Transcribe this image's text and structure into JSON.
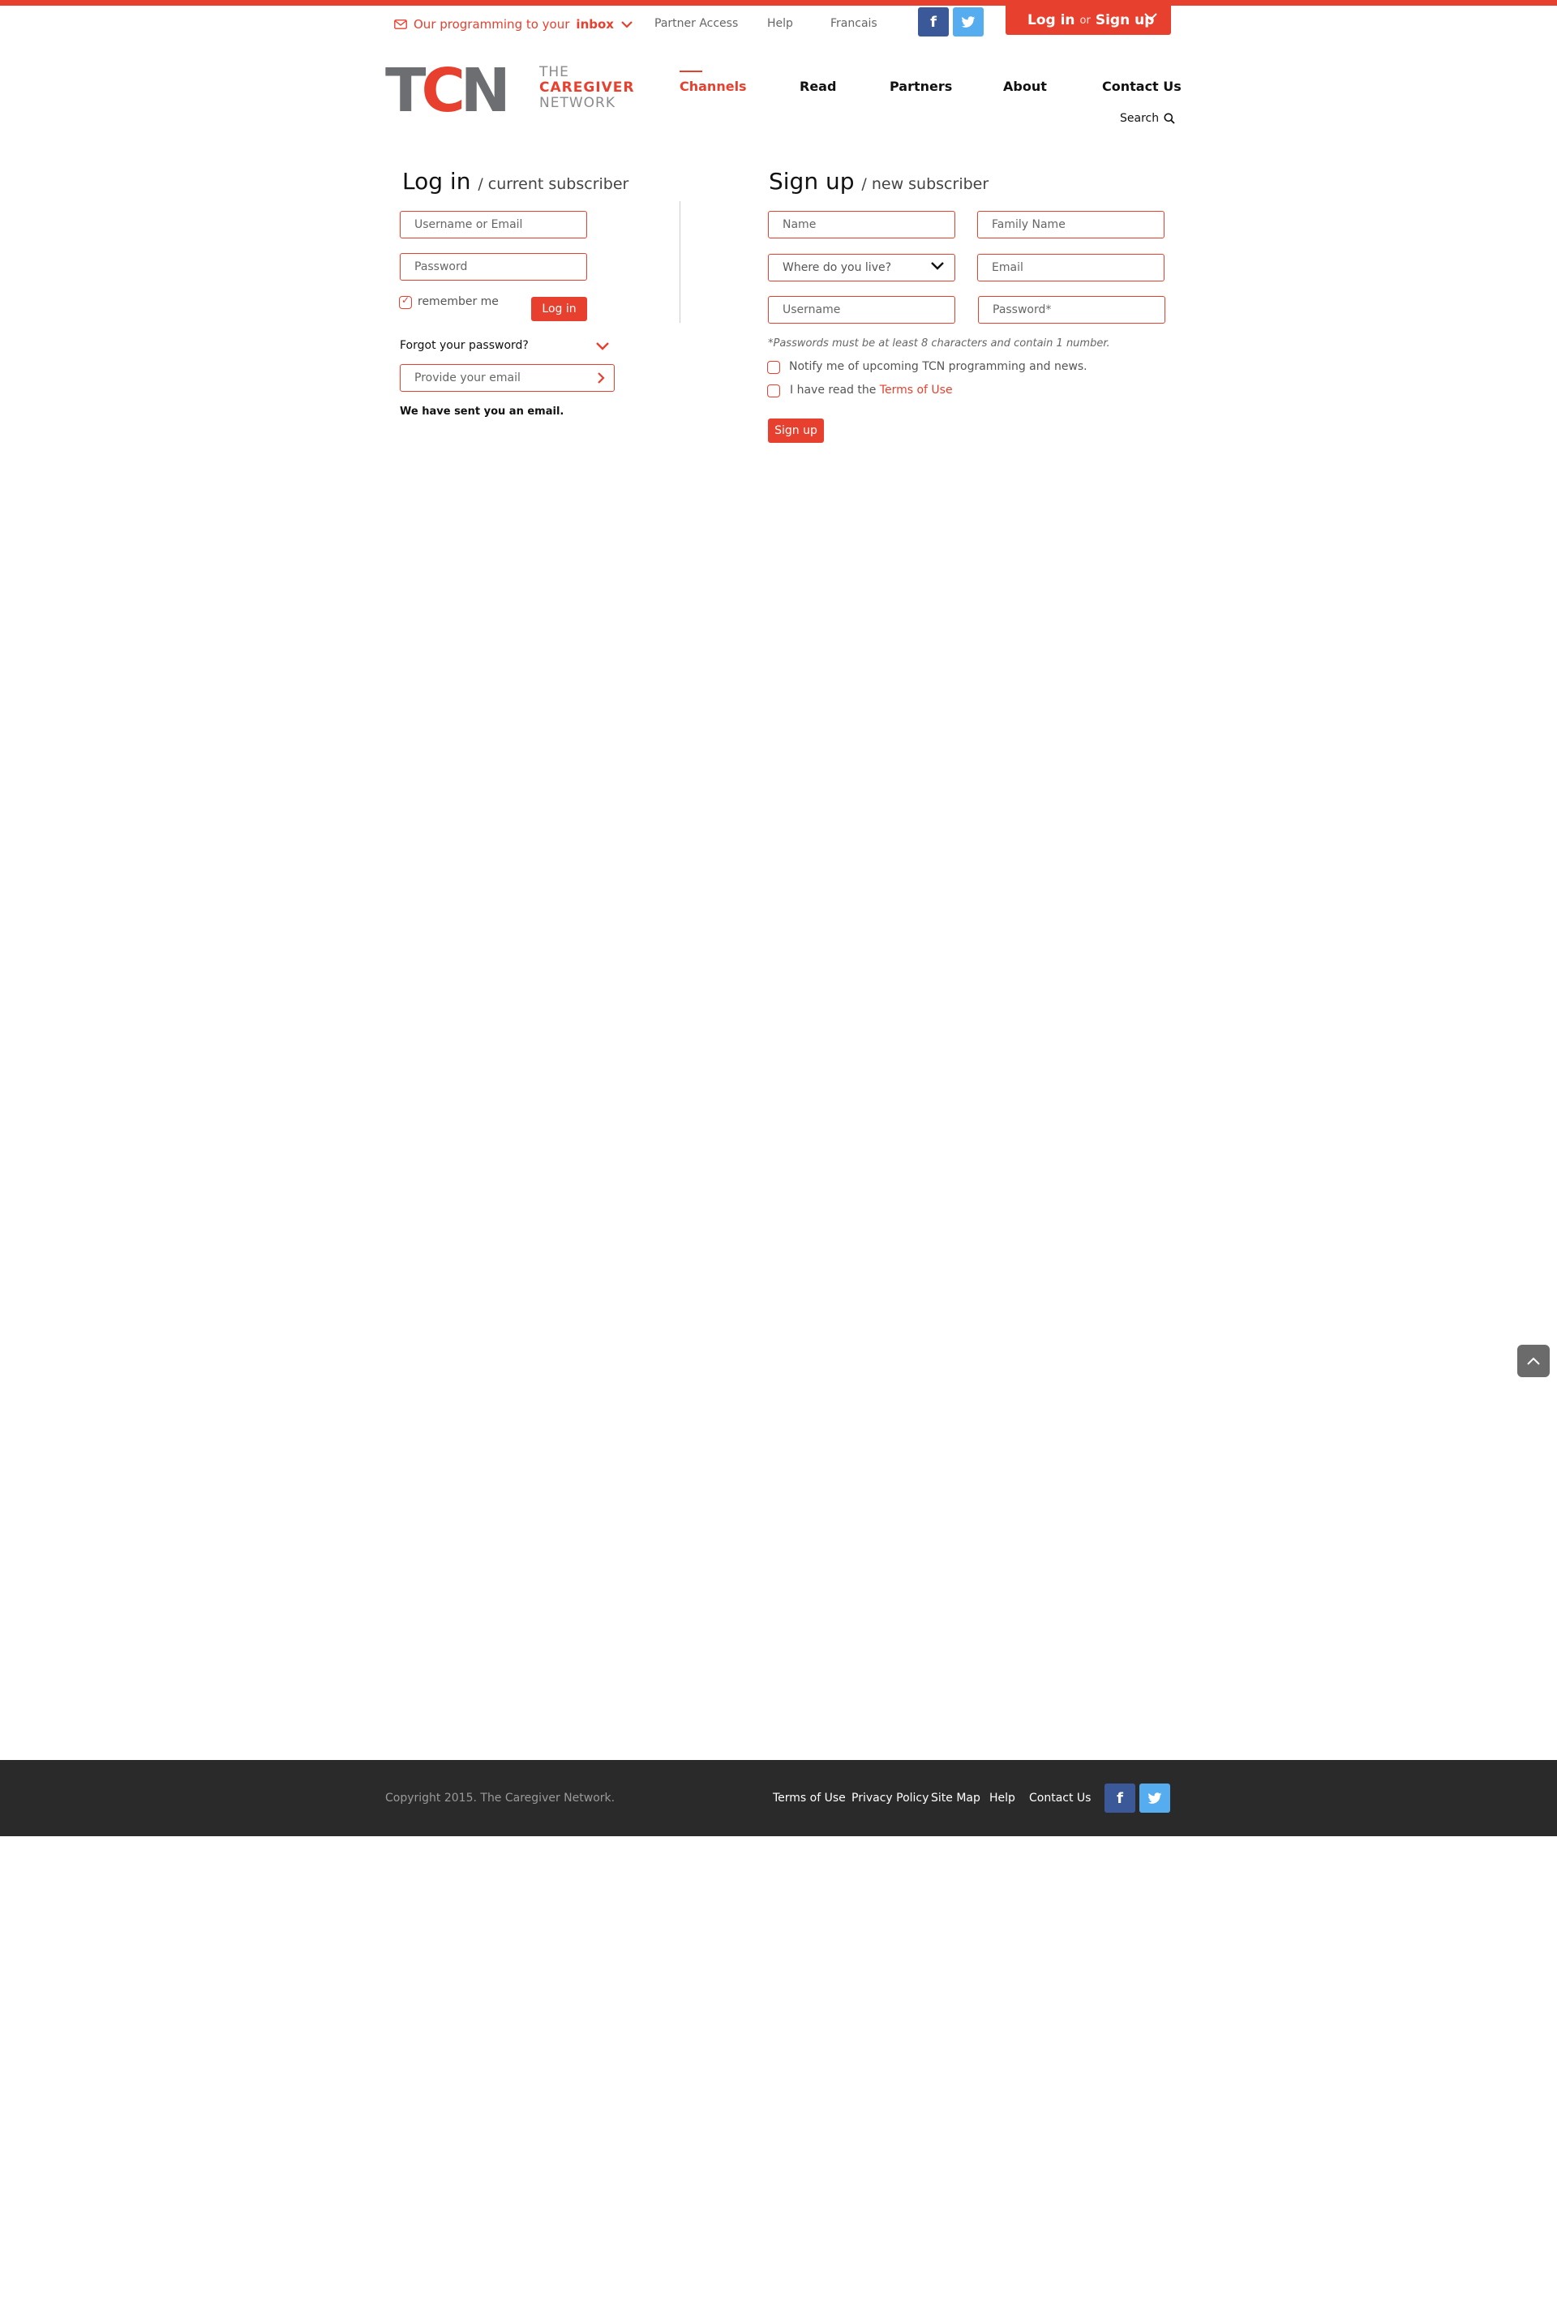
{
  "utility": {
    "programming_pre": "Our programming to your",
    "programming_bold": "inbox",
    "partner_access": "Partner Access",
    "help": "Help",
    "language": "Francais",
    "facebook": "f",
    "auth_login": "Log in",
    "auth_or": "or",
    "auth_signup": "Sign up"
  },
  "logo": {
    "t": "T",
    "c": "C",
    "n": "N",
    "line1": "THE",
    "line2": "CAREGIVER",
    "line3": "NETWORK"
  },
  "nav": {
    "channels": "Channels",
    "read": "Read",
    "partners": "Partners",
    "about": "About",
    "contact": "Contact Us",
    "search": "Search"
  },
  "login": {
    "title": "Log in",
    "subtitle": "/ current subscriber",
    "username_placeholder": "Username or Email",
    "password_placeholder": "Password",
    "remember": "remember me",
    "button": "Log in",
    "forgot": "Forgot your password?",
    "email_placeholder": "Provide your email",
    "sent_message": "We have sent you an email."
  },
  "signup": {
    "title": "Sign up",
    "subtitle": "/ new subscriber",
    "name_placeholder": "Name",
    "family_placeholder": "Family Name",
    "location_value": "Where do you live?",
    "email_placeholder": "Email",
    "username_placeholder": "Username",
    "password_placeholder": "Password*",
    "password_note": "*Passwords must be at least 8 characters and contain 1 number.",
    "notify": "Notify me of upcoming TCN programming and news.",
    "terms_pre": "I have read the",
    "terms_link": "Terms of Use",
    "button": "Sign up"
  },
  "footer": {
    "copyright": "Copyright 2015. The Caregiver Network.",
    "terms": "Terms of Use",
    "privacy": "Privacy Policy",
    "sitemap": "Site Map",
    "help": "Help",
    "contact": "Contact Us",
    "facebook": "f"
  },
  "colors": {
    "accent": "#e8402e",
    "facebook": "#3b5998",
    "twitter": "#55acee",
    "footer_bg": "#2a2a2a"
  }
}
